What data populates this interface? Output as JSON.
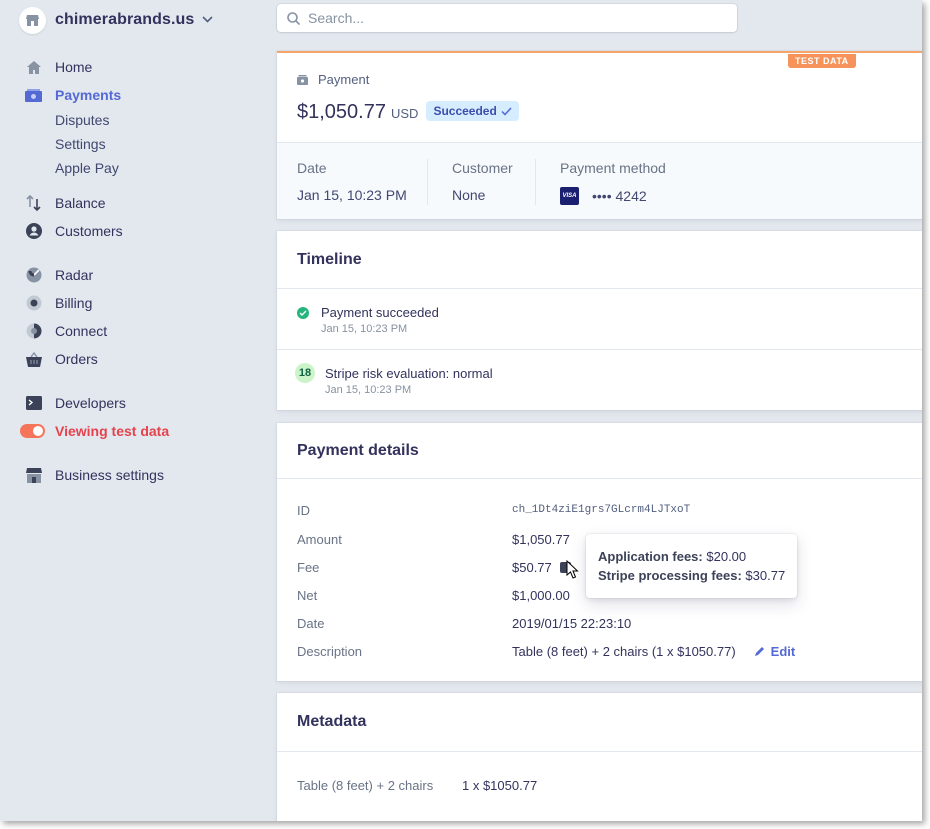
{
  "account": {
    "name": "chimerabrands.us"
  },
  "search": {
    "placeholder": "Search..."
  },
  "nav": {
    "home": "Home",
    "payments": "Payments",
    "disputes": "Disputes",
    "settings": "Settings",
    "apple_pay": "Apple Pay",
    "balance": "Balance",
    "customers": "Customers",
    "radar": "Radar",
    "billing": "Billing",
    "connect": "Connect",
    "orders": "Orders",
    "developers": "Developers",
    "viewing_test_data": "Viewing test data",
    "business_settings": "Business settings"
  },
  "payment": {
    "test_badge": "TEST DATA",
    "label": "Payment",
    "amount": "$1,050.77",
    "currency": "USD",
    "status": "Succeeded",
    "date_label": "Date",
    "date_value": "Jan 15, 10:23 PM",
    "customer_label": "Customer",
    "customer_value": "None",
    "method_label": "Payment method",
    "card_brand": "VISA",
    "card_last4": "•••• 4242"
  },
  "timeline": {
    "title": "Timeline",
    "events": [
      {
        "title": "Payment succeeded",
        "time": "Jan 15, 10:23 PM"
      },
      {
        "badge": "18",
        "title": "Stripe risk evaluation: normal",
        "time": "Jan 15, 10:23 PM"
      }
    ]
  },
  "details": {
    "title": "Payment details",
    "rows": [
      {
        "key": "ID",
        "value": "ch_1Dt4ziE1grs7GLcrm4LJTxoT"
      },
      {
        "key": "Amount",
        "value": "$1,050.77"
      },
      {
        "key": "Fee",
        "value": "$50.77"
      },
      {
        "key": "Net",
        "value": "$1,000.00"
      },
      {
        "key": "Date",
        "value": "2019/01/15 22:23:10"
      },
      {
        "key": "Description",
        "value": "Table (8 feet) + 2 chairs (1 x $1050.77)"
      }
    ],
    "edit_label": "Edit",
    "tooltip": {
      "app_fees_label": "Application fees:",
      "app_fees_value": "$20.00",
      "processing_label": "Stripe processing fees:",
      "processing_value": "$30.77"
    }
  },
  "metadata": {
    "title": "Metadata",
    "key": "Table (8 feet) + 2 chairs",
    "value": "1 x $1050.77"
  },
  "colors": {
    "accent": "#5469d4",
    "test_orange": "#f5935a",
    "success": "#24b47e",
    "background": "#e3e8ee"
  }
}
